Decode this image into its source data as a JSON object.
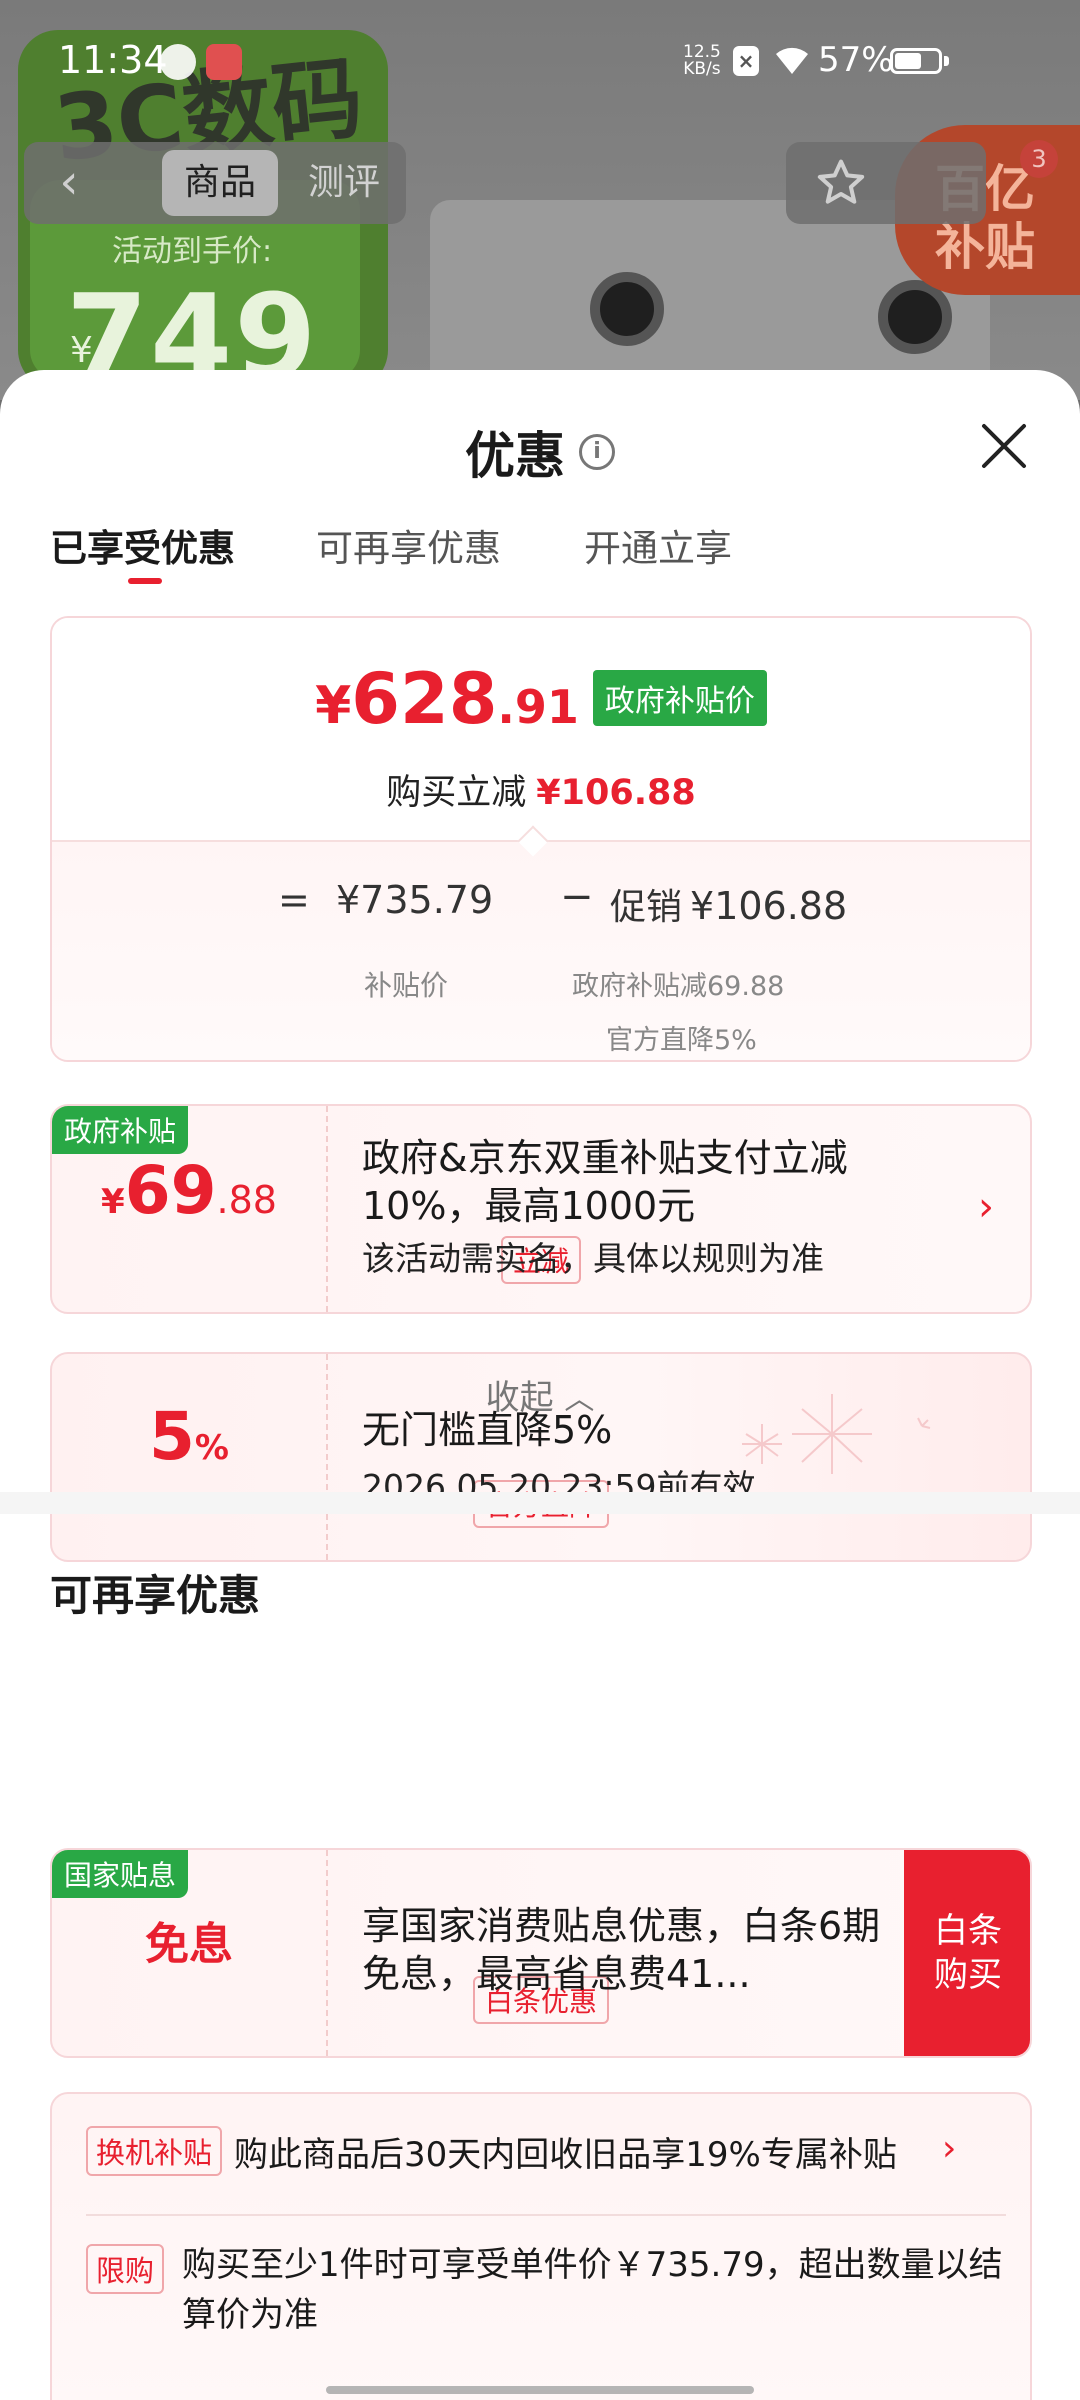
{
  "status_bar": {
    "time": "11:34",
    "net_speed_value": "12.5",
    "net_speed_unit": "KB/s",
    "battery": "57%"
  },
  "background": {
    "poster_label": "活动到手价:",
    "poster_price": "749",
    "poster_currency": "¥",
    "badge_text_line1": "百亿",
    "badge_text_line2": "补贴",
    "badge_count": "3"
  },
  "top_nav": {
    "tab_goods": "商品",
    "tab_review": "测评"
  },
  "sheet": {
    "title": "优惠",
    "tabs": [
      {
        "label": "已享受优惠"
      },
      {
        "label": "可再享优惠"
      },
      {
        "label": "开通立享"
      }
    ]
  },
  "summary": {
    "currency": "¥",
    "final_price_int": "628",
    "final_price_dec": ".91",
    "price_tag": "政府补贴价",
    "reduce_label": "购买立减",
    "reduce_amount": "¥106.88",
    "eq": "=",
    "subsidy_price": "¥735.79",
    "minus": "−",
    "promo_label": "促销",
    "promo_amount": "¥106.88",
    "subsidy_price_label": "补贴价",
    "detail_1": "政府补贴减69.88",
    "detail_2": "官方直降5%"
  },
  "coupons": [
    {
      "corner_tag": "政府补贴",
      "amount_yen": "¥",
      "amount_int": "69",
      "amount_dec": ".88",
      "badge": "立减",
      "title": "政府&京东双重补贴支付立减10%，最高1000元",
      "subtitle": "该活动需实名，具体以规则为准"
    },
    {
      "amount_int": "5",
      "amount_unit": "%",
      "badge": "官方直降",
      "title": "无门槛直降5%",
      "subtitle": "2026.05.20 23:59前有效"
    }
  ],
  "collapse_label": "收起",
  "more_section": {
    "title": "可再享优惠",
    "card": {
      "corner_tag": "国家贴息",
      "amount": "免息",
      "badge": "白条优惠",
      "title": "享国家消费贴息优惠，白条6期免息，最高省息费41...",
      "button_line1": "白条",
      "button_line2": "购买"
    },
    "misc": {
      "tag1": "换机补贴",
      "text1": "购此商品后30天内回收旧品享19%专属补贴",
      "tag2": "限购",
      "text2": "购买至少1件时可享受单件价￥735.79，超出数量以结算价为准"
    }
  },
  "colors": {
    "accent_red": "#e8202f",
    "gov_green": "#29a845"
  }
}
